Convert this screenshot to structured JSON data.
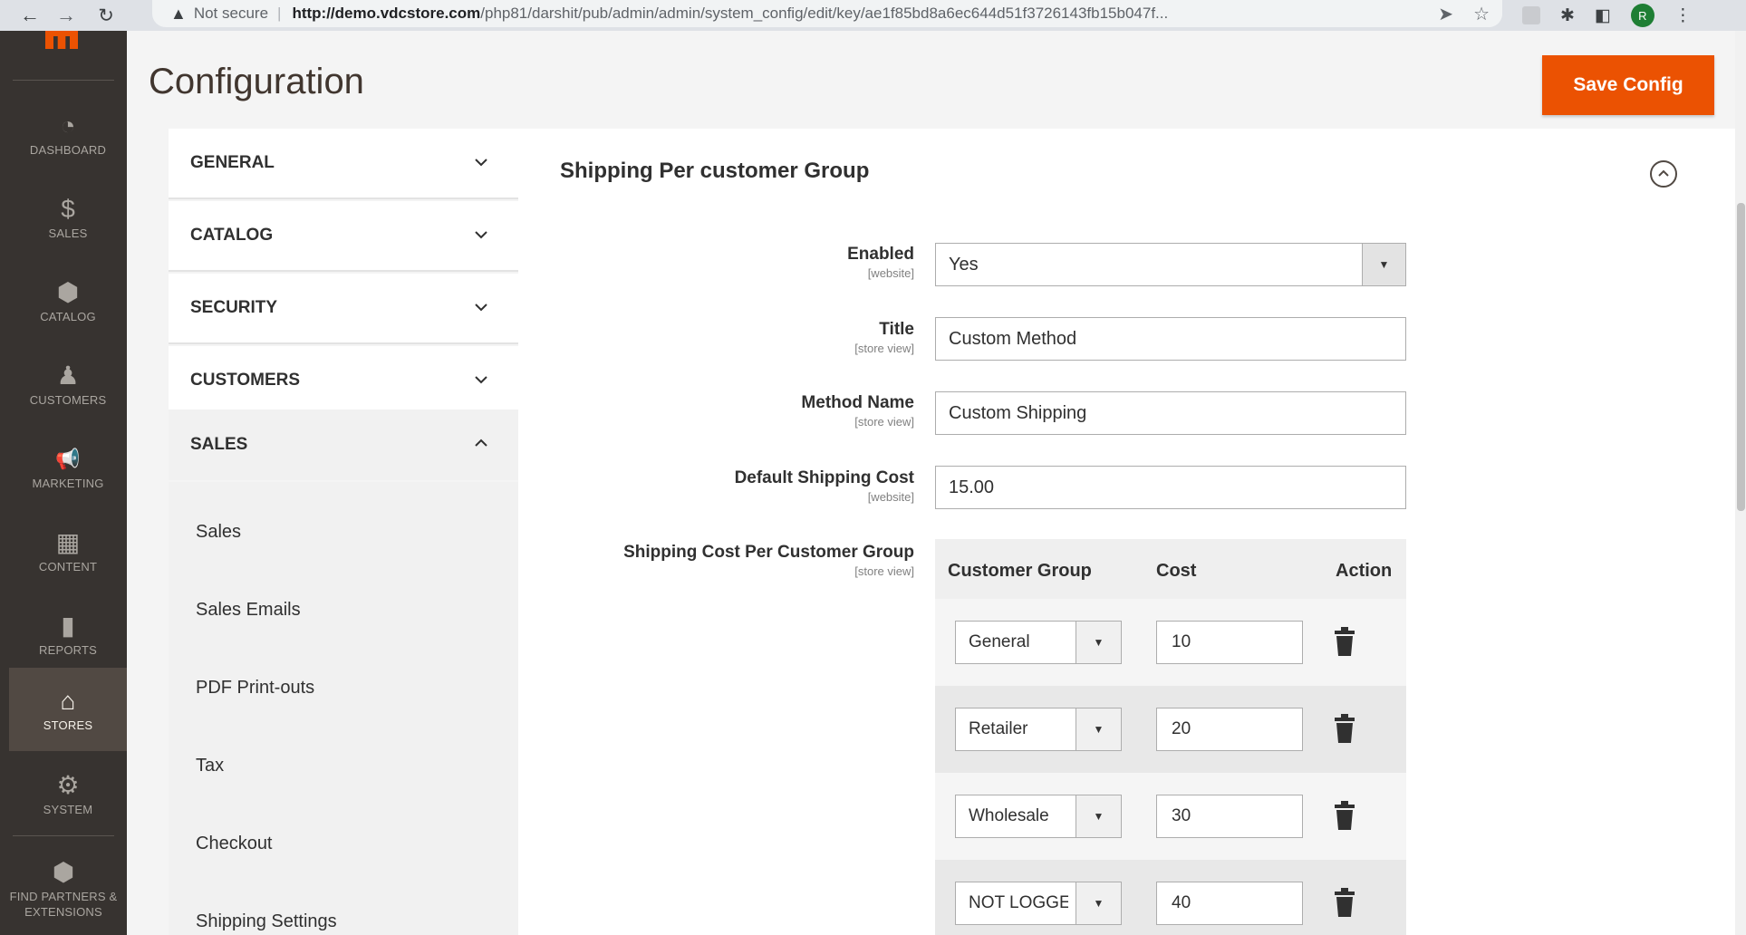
{
  "browser": {
    "security_label": "Not secure",
    "url_host": "http://demo.vdcstore.com",
    "url_path": "/php81/darshit/pub/admin/admin/system_config/edit/key/ae1f85bd8a6ec644d51f3726143fb15b047f...",
    "profile_initial": "R"
  },
  "menu": {
    "items": [
      {
        "label": "DASHBOARD",
        "icon": "dashboard-icon",
        "glyph": "◔"
      },
      {
        "label": "SALES",
        "icon": "dollar-icon",
        "glyph": "$"
      },
      {
        "label": "CATALOG",
        "icon": "box-icon",
        "glyph": "⬢"
      },
      {
        "label": "CUSTOMERS",
        "icon": "person-icon",
        "glyph": "♟"
      },
      {
        "label": "MARKETING",
        "icon": "megaphone-icon",
        "glyph": "📢"
      },
      {
        "label": "CONTENT",
        "icon": "layout-icon",
        "glyph": "▦"
      },
      {
        "label": "REPORTS",
        "icon": "bar-chart-icon",
        "glyph": "▮"
      },
      {
        "label": "STORES",
        "icon": "store-icon",
        "glyph": "⌂"
      },
      {
        "label": "SYSTEM",
        "icon": "gear-icon",
        "glyph": "⚙"
      },
      {
        "label": "FIND PARTNERS & EXTENSIONS",
        "icon": "partners-box-icon",
        "glyph": "⬢"
      }
    ]
  },
  "header": {
    "title": "Configuration",
    "save_label": "Save Config"
  },
  "config_nav": {
    "sections": [
      {
        "label": "GENERAL",
        "expanded": false
      },
      {
        "label": "CATALOG",
        "expanded": false
      },
      {
        "label": "SECURITY",
        "expanded": false
      },
      {
        "label": "CUSTOMERS",
        "expanded": false
      },
      {
        "label": "SALES",
        "expanded": true
      }
    ],
    "sales_items": [
      "Sales",
      "Sales Emails",
      "PDF Print-outs",
      "Tax",
      "Checkout",
      "Shipping Settings"
    ]
  },
  "panel": {
    "section_title": "Shipping Per customer Group",
    "fields": {
      "enabled": {
        "label": "Enabled",
        "scope": "[website]",
        "value": "Yes"
      },
      "title": {
        "label": "Title",
        "scope": "[store view]",
        "value": "Custom Method"
      },
      "method_name": {
        "label": "Method Name",
        "scope": "[store view]",
        "value": "Custom Shipping"
      },
      "default_cost": {
        "label": "Default Shipping Cost",
        "scope": "[website]",
        "value": "15.00"
      },
      "per_group": {
        "label": "Shipping Cost Per Customer Group",
        "scope": "[store view]"
      }
    },
    "grid": {
      "headers": {
        "group": "Customer Group",
        "cost": "Cost",
        "action": "Action"
      },
      "rows": [
        {
          "group": "General",
          "cost": "10"
        },
        {
          "group": "Retailer",
          "cost": "20"
        },
        {
          "group": "Wholesale",
          "cost": "30"
        },
        {
          "group": "NOT LOGGED IN",
          "cost": "40"
        }
      ]
    }
  },
  "colors": {
    "accent": "#eb5202",
    "menu_bg": "#373330",
    "menu_active": "#514943"
  }
}
